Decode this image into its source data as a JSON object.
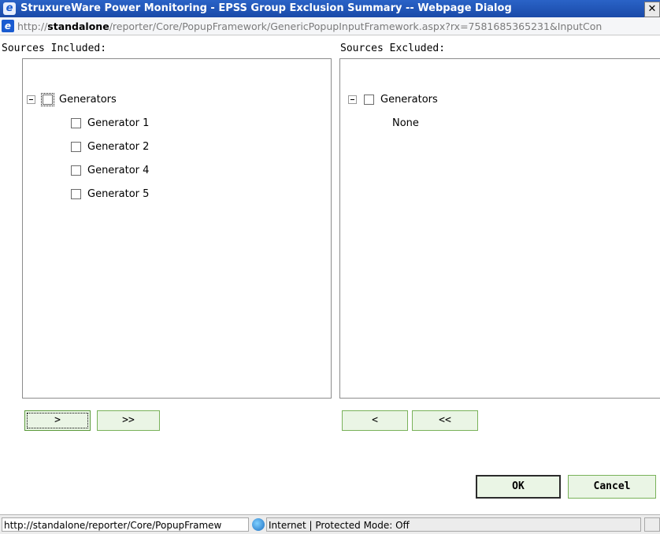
{
  "window": {
    "title": "StruxureWare Power Monitoring - EPSS Group Exclusion Summary -- Webpage Dialog",
    "close_symbol": "✕"
  },
  "address": {
    "prefix": "http://",
    "host": "standalone",
    "path": "/reporter/Core/PopupFramework/GenericPopupInputFramework.aspx?rx=7581685365231&InputCon"
  },
  "included": {
    "label": "Sources Included:",
    "group": "Generators",
    "items": [
      "Generator 1",
      "Generator 2",
      "Generator 4",
      "Generator 5"
    ]
  },
  "excluded": {
    "label": "Sources Excluded:",
    "group": "Generators",
    "empty_text": "None"
  },
  "buttons": {
    "move_right": ">",
    "move_all_right": ">>",
    "move_left": "<",
    "move_all_left": "<<",
    "ok": "OK",
    "cancel": "Cancel"
  },
  "status": {
    "url": "http://standalone/reporter/Core/PopupFramew",
    "zone": "Internet | Protected Mode: Off"
  }
}
